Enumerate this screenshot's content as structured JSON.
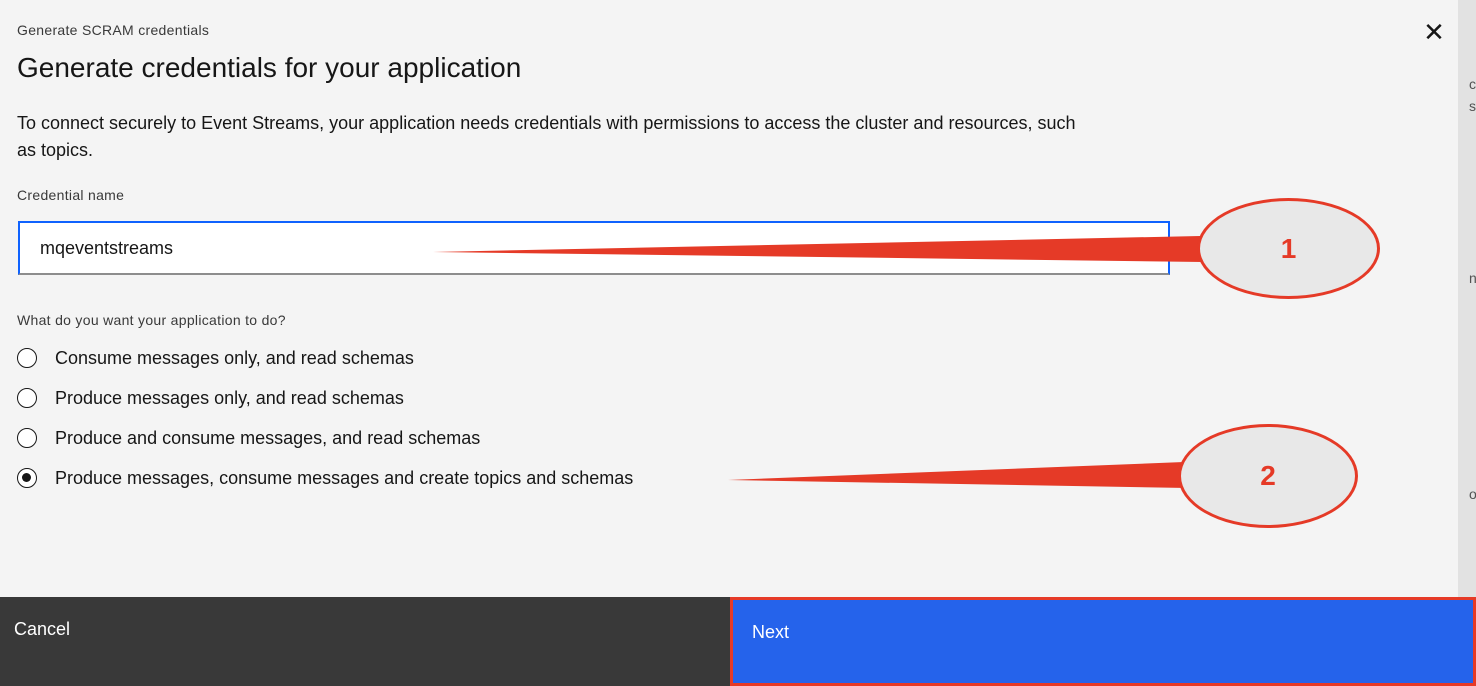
{
  "modal": {
    "label": "Generate SCRAM credentials",
    "title": "Generate credentials for your application",
    "description": "To connect securely to Event Streams, your application needs credentials with permissions to access the cluster and resources, such as topics.",
    "close_icon": "close-icon"
  },
  "credential": {
    "label": "Credential name",
    "value": "mqeventstreams"
  },
  "permissions": {
    "question": "What do you want your application to do?",
    "options": [
      {
        "label": "Consume messages only, and read schemas",
        "checked": false
      },
      {
        "label": "Produce messages only, and read schemas",
        "checked": false
      },
      {
        "label": "Produce and consume messages, and read schemas",
        "checked": false
      },
      {
        "label": "Produce messages, consume messages and create topics and schemas",
        "checked": true
      }
    ]
  },
  "footer": {
    "cancel_label": "Cancel",
    "next_label": "Next"
  },
  "annotations": {
    "callout_1": "1",
    "callout_2": "2",
    "color": "#e53a27"
  },
  "background_strip": {
    "fragments": [
      "c",
      "s",
      "n",
      "o"
    ]
  },
  "colors": {
    "primary": "#2563eb",
    "secondary_button": "#393939",
    "focus": "#0f62fe"
  }
}
